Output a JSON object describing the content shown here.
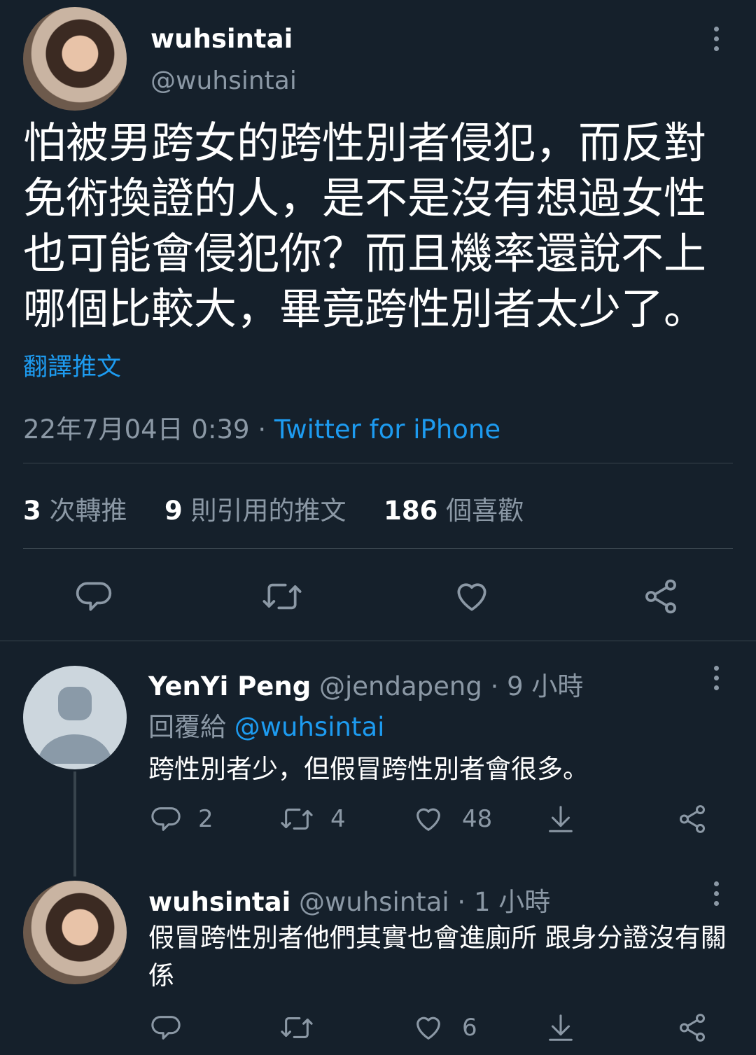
{
  "main_tweet": {
    "display_name": "wuhsintai",
    "handle": "@wuhsintai",
    "text": "怕被男跨女的跨性別者侵犯，而反對免術換證的人，是不是沒有想過女性也可能會侵犯你？而且機率還說不上哪個比較大，畢竟跨性別者太少了。",
    "translate_label": "翻譯推文",
    "timestamp": "22年7月04日 0:39",
    "separator": " · ",
    "client": "Twitter for iPhone",
    "stats": {
      "retweets_count": "3",
      "retweets_label": "次轉推",
      "quotes_count": "9",
      "quotes_label": "則引用的推文",
      "likes_count": "186",
      "likes_label": "個喜歡"
    }
  },
  "replies": [
    {
      "display_name": "YenYi Peng",
      "handle": "@jendapeng",
      "time": "· 9 小時",
      "reply_to_label": "回覆給",
      "reply_to_handle": "@wuhsintai",
      "text": "跨性別者少，但假冒跨性別者會很多。",
      "reply_count": "2",
      "retweet_count": "4",
      "like_count": "48"
    },
    {
      "display_name": "wuhsintai",
      "handle": "@wuhsintai",
      "time": "· 1 小時",
      "text": "假冒跨性別者他們其實也會進廁所 跟身分證沒有關係",
      "like_count": "6"
    }
  ],
  "colors": {
    "background": "#15202b",
    "accent": "#1d9bf0",
    "muted": "#8b98a5",
    "divider": "#38444d"
  },
  "icons": [
    "more-icon",
    "reply-icon",
    "retweet-icon",
    "like-icon",
    "share-icon",
    "download-icon",
    "default-avatar-icon"
  ]
}
